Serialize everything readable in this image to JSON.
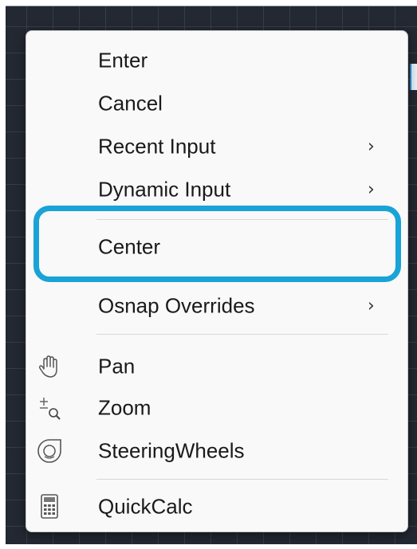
{
  "context_menu": {
    "items": [
      {
        "label": "Enter",
        "has_submenu": false
      },
      {
        "label": "Cancel",
        "has_submenu": false
      },
      {
        "label": "Recent Input",
        "has_submenu": true
      },
      {
        "label": "Dynamic Input",
        "has_submenu": true
      },
      {
        "label": "Center",
        "has_submenu": false,
        "highlighted": true
      },
      {
        "label": "Osnap Overrides",
        "has_submenu": true
      },
      {
        "label": "Pan",
        "icon": "pan-hand-icon",
        "has_submenu": false
      },
      {
        "label": "Zoom",
        "icon": "zoom-icon",
        "has_submenu": false
      },
      {
        "label": "SteeringWheels",
        "icon": "steering-wheel-icon",
        "has_submenu": false
      },
      {
        "label": "QuickCalc",
        "icon": "calculator-icon",
        "has_submenu": false
      }
    ],
    "submenu_glyph": "›",
    "highlight_color": "#1aa3d6"
  }
}
